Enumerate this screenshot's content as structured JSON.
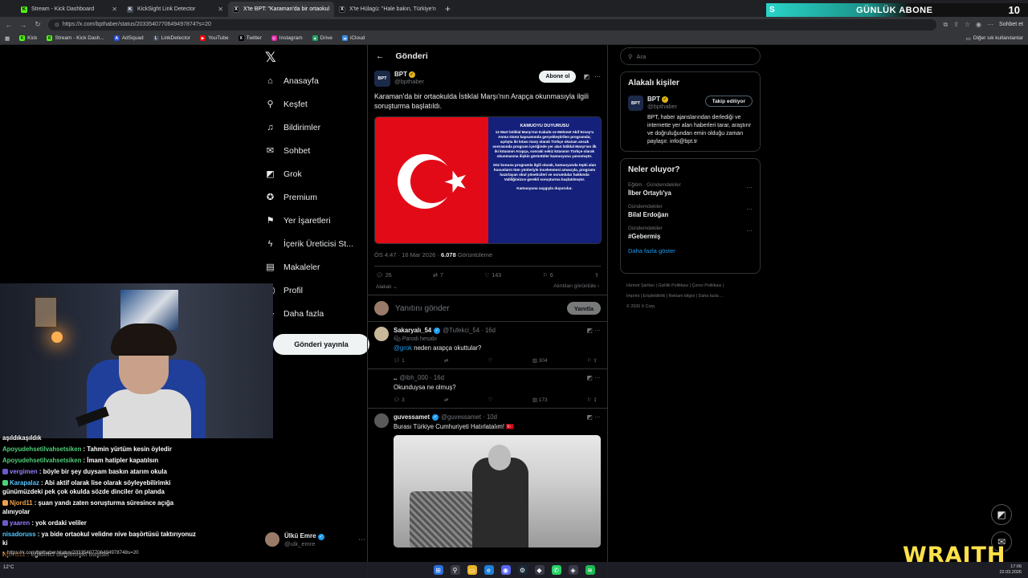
{
  "browser": {
    "tabs": [
      {
        "label": "Stream - Kick Dashboard",
        "favicon": "kick-icon",
        "color": "#53fc18",
        "active": false
      },
      {
        "label": "KickSight Link Detector",
        "favicon": "kicksight-icon",
        "color": "#444a5a",
        "active": false
      },
      {
        "label": "X'te BPT: \"Karaman'da bir ortaokul",
        "favicon": "x-icon",
        "color": "#000000",
        "active": true
      },
      {
        "label": "X'te Hülagü: \"Hale bakın, Türkiye'n",
        "favicon": "x-icon",
        "color": "#000000",
        "active": false
      }
    ],
    "url": "https://x.com/bpthaber/status/2033540770649497874?s=20",
    "chat_button": "Sohbet et",
    "bookmarks": [
      {
        "label": "Kick",
        "color": "#53fc18",
        "glyph": "K"
      },
      {
        "label": "Stream - Kick Dash...",
        "color": "#53fc18",
        "glyph": "K"
      },
      {
        "label": "AdSquad",
        "color": "#2a4fd6",
        "glyph": "A"
      },
      {
        "label": "LinkDetector",
        "color": "#444a5a",
        "glyph": "L"
      },
      {
        "label": "YouTube",
        "color": "#ff0000",
        "glyph": "▶"
      },
      {
        "label": "Twitter",
        "color": "#000000",
        "glyph": "X"
      },
      {
        "label": "Instagram",
        "color": "#d6249f",
        "glyph": "◎"
      },
      {
        "label": "Drive",
        "color": "#1fa463",
        "glyph": "▲"
      },
      {
        "label": "iCloud",
        "color": "#3a8fe8",
        "glyph": "☁"
      }
    ],
    "other_bookmarks": "Diğer sık kullanılanlar"
  },
  "stream_overlay": {
    "goal_label": "GÜNLÜK ABONE",
    "goal_count": "10",
    "brand": "WRAITH"
  },
  "nav": {
    "items": [
      {
        "label": "Anasayfa",
        "icon": "home-icon",
        "glyph": "⌂"
      },
      {
        "label": "Keşfet",
        "icon": "search-icon",
        "glyph": "⚲"
      },
      {
        "label": "Bildirimler",
        "icon": "bell-icon",
        "glyph": "🔔"
      },
      {
        "label": "Sohbet",
        "icon": "mail-icon",
        "glyph": "✉"
      },
      {
        "label": "Grok",
        "icon": "grok-icon",
        "glyph": "◩"
      },
      {
        "label": "Premium",
        "icon": "premium-icon",
        "glyph": "✪"
      },
      {
        "label": "Yer İşaretleri",
        "icon": "bookmark-icon",
        "glyph": "⚑"
      },
      {
        "label": "İçerik Üreticisi St...",
        "icon": "lightning-icon",
        "glyph": "⚡"
      },
      {
        "label": "Makaleler",
        "icon": "article-icon",
        "glyph": "▤"
      },
      {
        "label": "Profil",
        "icon": "profile-icon",
        "glyph": "◯"
      },
      {
        "label": "Daha fazla",
        "icon": "more-icon",
        "glyph": "⋯"
      }
    ],
    "post_button": "Gönderi yayınla",
    "account": {
      "name": "Ülkü Emre",
      "handle": "@ulk_emre"
    }
  },
  "main": {
    "header": "Gönderi",
    "post": {
      "author": "BPT",
      "handle": "@bpthaber",
      "subscribe": "Abone ol",
      "text": "Karaman'da bir ortaokulda İstiklal Marşı'nın Arapça okunmasıyla ilgili soruşturma başlatıldı.",
      "notice": {
        "title": "KAMUOYU DUYURUSU",
        "p1": "12 Mart İstiklal Marşı'nın Kabulü ve Mehmet Akif Ersoy'u Anma Günü kapsamında gerçekleştirilen programda; açılışta iki kıtası marş olarak Türkçe okunan ancak sonrasında program içeriğinde yer alan İstiklal Marşı'nın ilk iki kıtasının Arapça, sonraki sekiz kıtasının Türkçe olarak okunmasına ilişkin görüntüler kamuoyuna yansımıştır.",
        "p2": "Söz konusu programla ilgili olarak, kamuoyunda tepki alan hususların tüm yönleriyle incelenmesi amacıyla, programı hazırlayan okul yöneticileri ve sorumlular hakkında Valiliğimizce gerekli soruşturma başlatılmıştır.",
        "p3": "Kamuoyuna saygıyla duyurulur."
      },
      "time": "ÖS 4:47 · 16 Mar 2026 ·",
      "views": "6.078",
      "views_label": "Görüntüleme",
      "replies": "26",
      "reposts": "7",
      "likes": "143",
      "bookmarks": "6",
      "relevant": "Alakalı",
      "quotes": "Alıntıları görüntüle"
    },
    "reply_box": {
      "placeholder": "Yanıtını gönder",
      "button": "Yanıtla"
    },
    "replies": [
      {
        "name": "Sakaryalı_54",
        "handle": "@Tufekci_54 · 16d",
        "tag": "Parodi hesabı",
        "mention": "@grok",
        "text": " neden arapça okuttular?",
        "replies": "1",
        "views": "304",
        "avatar_color": "#c9b89a"
      },
      {
        "name": "..",
        "handle": "@ibh_000 · 16d",
        "tag": "",
        "mention": "",
        "text": "Okunduysa ne olmuş?",
        "replies": "3",
        "views": "173",
        "avatar_color": "#000000"
      },
      {
        "name": "guvessamet",
        "handle": "@guvessamet · 10d",
        "tag": "",
        "mention": "",
        "text": "Burası Türkiye Cumhuriyeti Hatırlatalım! 🇹🇷",
        "replies": "",
        "views": "",
        "avatar_color": "#5a5a5a"
      }
    ]
  },
  "right": {
    "search_placeholder": "Ara",
    "related": {
      "title": "Alakalı kişiler",
      "name": "BPT",
      "handle": "@bpthaber",
      "follow": "Takip ediliyor",
      "bio": "BPT, haber ajanslarından derlediği ve internette yer alan haberleri tarar, araştırır ve doğruluğundan emin olduğu zaman paylaşır. info@bpt.tr"
    },
    "trends": {
      "title": "Neler oluyor?",
      "items": [
        {
          "category": "Eğitim · Gündemdekiler",
          "topic": "İlber Ortaylı'ya"
        },
        {
          "category": "Gündemdekiler",
          "topic": "Bilal Erdoğan"
        },
        {
          "category": "Gündemdekiler",
          "topic": "#Gebermiş"
        }
      ],
      "show_more": "Daha fazla göster"
    },
    "footer": [
      "Hizmet Şartları",
      "Gizlilik Politikası",
      "Çerez Politikası",
      "Imprint",
      "Erişilebilirlik",
      "Reklam bilgisi",
      "Daha fazla ...",
      "© 2026 X Corp."
    ]
  },
  "chat": {
    "messages": [
      {
        "user": "",
        "text": "aşıldıkaşıldık",
        "color": "default"
      },
      {
        "user": "Apoyudehsetilvahsetsiken",
        "text": ": Tahmin yürtüm kesin öyledir",
        "color": "green"
      },
      {
        "user": "Apoyudehsetilvahsetsiken",
        "text": ": İmam hatipler kapatılsın",
        "color": "green"
      },
      {
        "user": "vergimen",
        "text": ": böyle bir şey duysam baskın atarım okula",
        "color": "purple"
      },
      {
        "user": "Karapalaz",
        "text": ": Abi aktif olarak lise olarak söyleyebilirimki günümüzdeki pek çok okulda sözde dinciler ön planda",
        "color": "blue"
      },
      {
        "user": "Njord11",
        "text": ": şuan yandı zaten soruşturma süresince açığa alınıyolar",
        "color": "orange"
      },
      {
        "user": "yaaren",
        "text": ": yok ordaki veliler",
        "color": "purple"
      },
      {
        "user": "nisadoruss",
        "text": ": ya bide ortaokul velidne nive başörtüsü taktırıyonuz ki",
        "color": "blue"
      },
      {
        "user": "Njord11",
        "text": ": eğitimci değilmişki baştan",
        "color": "orange"
      }
    ],
    "status_url": "https://x.com/bpthaber/status/20335407706494978748s=20"
  },
  "taskbar": {
    "weather": "12°C",
    "time": "17:06",
    "date": "22.03.2026"
  }
}
